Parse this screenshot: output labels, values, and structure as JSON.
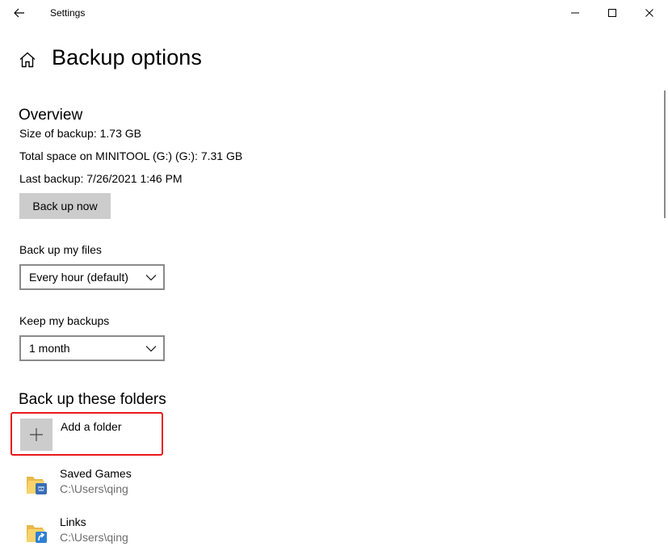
{
  "window": {
    "title": "Settings"
  },
  "page": {
    "title": "Backup options"
  },
  "overview": {
    "heading": "Overview",
    "size_of_backup": "Size of backup: 1.73 GB",
    "total_space": "Total space on MINITOOL (G:) (G:): 7.31 GB",
    "last_backup": "Last backup: 7/26/2021 1:46 PM",
    "backup_now_label": "Back up now"
  },
  "backup_frequency": {
    "label": "Back up my files",
    "selected": "Every hour (default)"
  },
  "keep_backups": {
    "label": "Keep my backups",
    "selected": "1 month"
  },
  "folders": {
    "heading": "Back up these folders",
    "add_label": "Add a folder",
    "items": [
      {
        "name": "Saved Games",
        "path": "C:\\Users\\qing"
      },
      {
        "name": "Links",
        "path": "C:\\Users\\qing"
      }
    ]
  },
  "colors": {
    "highlight_border": "#e8181c",
    "button_bg": "#cccccc",
    "secondary_text": "#6d6d6d",
    "dropdown_border": "#8a8a8a"
  },
  "icons": {
    "back": "arrow-left-icon",
    "minimize": "minimize-icon",
    "maximize": "maximize-icon",
    "close": "close-icon",
    "home": "home-icon",
    "dropdown": "chevron-down-icon",
    "add": "plus-icon",
    "folder": "folder-icon"
  }
}
